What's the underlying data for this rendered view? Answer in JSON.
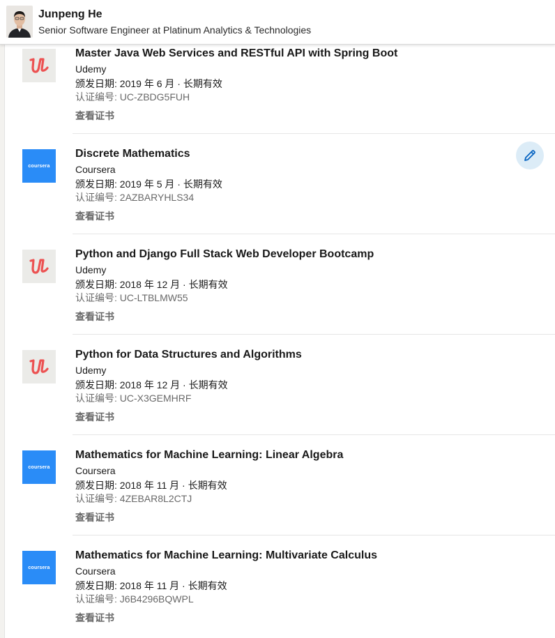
{
  "header": {
    "name": "Junpeng He",
    "title": "Senior Software Engineer at Platinum Analytics & Technologies"
  },
  "certifications": [
    {
      "logo": "udemy",
      "title": "Master Java Web Services and RESTful API with Spring Boot",
      "org": "Udemy",
      "date": "颁发日期: 2019 年 6 月 · 长期有效",
      "id": "认证编号: UC-ZBDG5FUH",
      "link": "查看证书"
    },
    {
      "logo": "coursera",
      "title": "Discrete Mathematics",
      "org": "Coursera",
      "date": "颁发日期: 2019 年 5 月 · 长期有效",
      "id": "认证编号: 2AZBARYHLS34",
      "link": "查看证书"
    },
    {
      "logo": "udemy",
      "title": "Python and Django Full Stack Web Developer Bootcamp",
      "org": "Udemy",
      "date": "颁发日期: 2018 年 12 月 · 长期有效",
      "id": "认证编号: UC-LTBLMW55",
      "link": "查看证书"
    },
    {
      "logo": "udemy",
      "title": "Python for Data Structures and Algorithms",
      "org": "Udemy",
      "date": "颁发日期: 2018 年 12 月 · 长期有效",
      "id": "认证编号: UC-X3GEMHRF",
      "link": "查看证书"
    },
    {
      "logo": "coursera",
      "title": "Mathematics for Machine Learning: Linear Algebra",
      "org": "Coursera",
      "date": "颁发日期: 2018 年 11 月 · 长期有效",
      "id": "认证编号: 4ZEBAR8L2CTJ",
      "link": "查看证书"
    },
    {
      "logo": "coursera",
      "title": "Mathematics for Machine Learning: Multivariate Calculus",
      "org": "Coursera",
      "date": "颁发日期: 2018 年 11 月 · 长期有效",
      "id": "认证编号: J6B4296BQWPL",
      "link": "查看证书"
    }
  ],
  "logos": {
    "udemy": {
      "icon": "udemy-logo-icon",
      "color": "#ec5252",
      "background": "#ebebe8"
    },
    "coursera": {
      "icon": "coursera-logo-icon",
      "text": "coursera",
      "background": "#2a8cf7"
    }
  },
  "edit": {
    "icon": "pencil-icon",
    "color": "#0a66c2"
  }
}
